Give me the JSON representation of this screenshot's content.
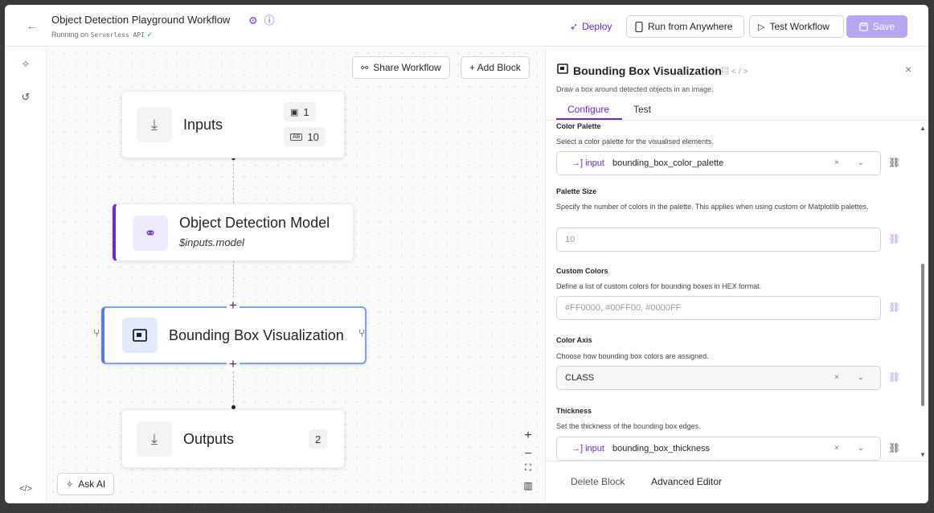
{
  "header": {
    "title": "Object Detection Playground Workflow",
    "subtitle_prefix": "Running on",
    "subtitle_env": "Serverless API",
    "subtitle_check": "✓",
    "deploy_label": "Deploy",
    "run_label": "Run from Anywhere",
    "test_label": "Test Workflow",
    "save_label": "Save"
  },
  "canvas": {
    "share_label": "Share Workflow",
    "add_block_label": "+ Add Block",
    "ask_ai_label": "Ask AI",
    "nodes": {
      "inputs": {
        "title": "Inputs",
        "image_count": "1",
        "param_count": "10",
        "param_tag": "AB"
      },
      "detection": {
        "title": "Object Detection Model",
        "subtitle": "$inputs.model"
      },
      "bbox": {
        "title": "Bounding Box Visualization"
      },
      "outputs": {
        "title": "Outputs",
        "count": "2"
      }
    },
    "zoom": {
      "in": "+",
      "out": "–",
      "fit": "⛶",
      "map": "▥"
    }
  },
  "panel": {
    "title": "Bounding Box Visualization",
    "description": "Draw a box around detected objects in an image.",
    "tabs": [
      "Configure",
      "Test"
    ],
    "fields": {
      "color_palette": {
        "label": "Color Palette",
        "help": "Select a color palette for the visualised elements.",
        "tag": "→] input",
        "value": "bounding_box_color_palette"
      },
      "palette_size": {
        "label": "Palette Size",
        "help": "Specify the number of colors in the palette. This applies when using custom or Matplotlib palettes.",
        "placeholder": "10"
      },
      "custom_colors": {
        "label": "Custom Colors",
        "help": "Define a list of custom colors for bounding boxes in HEX format.",
        "placeholder": "#FF0000, #00FF00, #0000FF"
      },
      "color_axis": {
        "label": "Color Axis",
        "help": "Choose how bounding box colors are assigned.",
        "value": "CLASS"
      },
      "thickness": {
        "label": "Thickness",
        "help": "Set the thickness of the bounding box edges.",
        "tag": "→] input",
        "value": "bounding_box_thickness"
      }
    },
    "delete_label": "Delete Block",
    "advanced_label": "Advanced Editor"
  },
  "colors": {
    "accent": "#6d28d9",
    "save_disabled": "#b8a6f3",
    "node_bar": "#6d28d9"
  }
}
